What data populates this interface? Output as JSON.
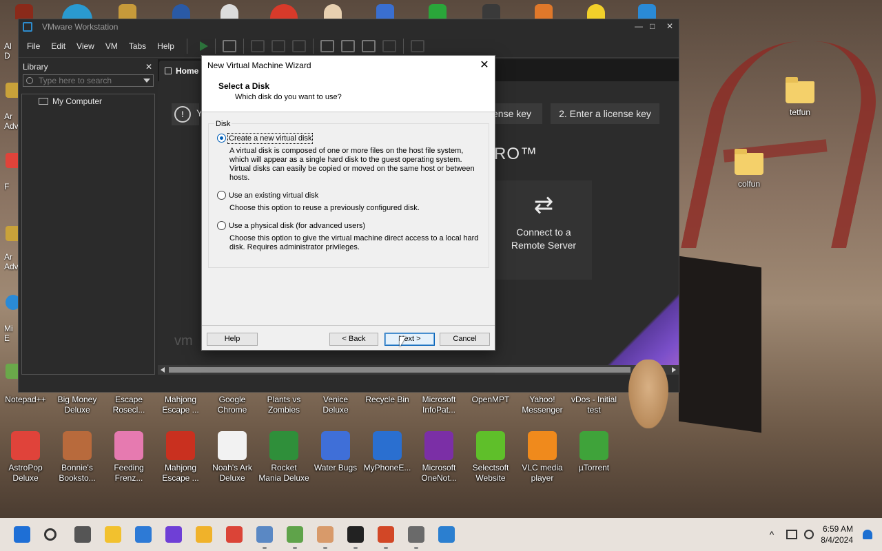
{
  "vmware": {
    "title": "VMware Workstation",
    "window_controls": {
      "minimize": "—",
      "maximize": "□",
      "close": "✕"
    },
    "menu": [
      "File",
      "Edit",
      "View",
      "VM",
      "Tabs",
      "Help"
    ],
    "library": {
      "title": "Library",
      "close": "✕",
      "search_placeholder": "Type here to search",
      "tree": [
        "My Computer"
      ]
    },
    "home_tab": "Home",
    "home": {
      "notice_glyph": "!",
      "notice_text": "Y",
      "license_btn_1": "ense key",
      "license_btn_2": "2. Enter a license key",
      "pro_mark": "RO™",
      "connect_card": {
        "line1": "Connect to a",
        "line2": "Remote Server",
        "icon": "swap-arrows-icon",
        "glyph": "⇄"
      },
      "logo_text": "vm"
    }
  },
  "dialog": {
    "title": "New Virtual Machine Wizard",
    "close": "✕",
    "heading": "Select a Disk",
    "subheading": "Which disk do you want to use?",
    "group_label": "Disk",
    "options": [
      {
        "label": "Create a new virtual disk",
        "selected": true,
        "description": "A virtual disk is composed of one or more files on the host file system, which will appear as a single hard disk to the guest operating system. Virtual disks can easily be copied or moved on the same host or between hosts."
      },
      {
        "label": "Use an existing virtual disk",
        "selected": false,
        "description": "Choose this option to reuse a previously configured disk."
      },
      {
        "label": "Use a physical disk (for advanced users)",
        "selected": false,
        "description": "Choose this option to give the virtual machine direct access to a local hard disk. Requires administrator privileges."
      }
    ],
    "buttons": {
      "help": "Help",
      "back": "< Back",
      "next": "Next >",
      "cancel": "Cancel"
    }
  },
  "desktop": {
    "right_folders": [
      "tetfun",
      "colfun"
    ],
    "row1": [
      {
        "line1": "Notepad++",
        "line2": ""
      },
      {
        "line1": "Big Money",
        "line2": "Deluxe"
      },
      {
        "line1": "Escape",
        "line2": "Rosecl..."
      },
      {
        "line1": "Mahjong",
        "line2": "Escape ..."
      },
      {
        "line1": "Google",
        "line2": "Chrome"
      },
      {
        "line1": "Plants vs",
        "line2": "Zombies"
      },
      {
        "line1": "Venice",
        "line2": "Deluxe"
      },
      {
        "line1": "Recycle Bin",
        "line2": ""
      },
      {
        "line1": "Microsoft",
        "line2": "InfoPat..."
      },
      {
        "line1": "OpenMPT",
        "line2": ""
      },
      {
        "line1": "Yahoo!",
        "line2": "Messenger"
      },
      {
        "line1": "vDos - Initial",
        "line2": "test"
      }
    ],
    "row2": [
      {
        "line1": "AstroPop",
        "line2": "Deluxe",
        "color": "#e0433a"
      },
      {
        "line1": "Bonnie's",
        "line2": "Booksto...",
        "color": "#b86a3c"
      },
      {
        "line1": "Feeding",
        "line2": "Frenz...",
        "color": "#e67ab0"
      },
      {
        "line1": "Mahjong",
        "line2": "Escape ...",
        "color": "#c9301f"
      },
      {
        "line1": "Noah's Ark",
        "line2": "Deluxe",
        "color": "#f2f2f2"
      },
      {
        "line1": "Rocket",
        "line2": "Mania Deluxe",
        "color": "#2f8f3a"
      },
      {
        "line1": "Water Bugs",
        "line2": "",
        "color": "#3f6fd8"
      },
      {
        "line1": "MyPhoneE...",
        "line2": "",
        "color": "#2a6fd0"
      },
      {
        "line1": "Microsoft",
        "line2": "OneNot...",
        "color": "#7b2fa6"
      },
      {
        "line1": "Selectsoft",
        "line2": "Website",
        "color": "#5fbf2a"
      },
      {
        "line1": "VLC media",
        "line2": "player",
        "color": "#f08a1c"
      },
      {
        "line1": "µTorrent",
        "line2": "",
        "color": "#3fa33a"
      }
    ],
    "left_partial": [
      "Al",
      "D",
      "Ar",
      "Adv",
      "F",
      "Ar",
      "Adv",
      "Mi",
      "E"
    ]
  },
  "taskbar": {
    "time": "6:59 AM",
    "date": "8/4/2024",
    "icons": [
      {
        "name": "start-icon",
        "color": "#1e6fd6"
      },
      {
        "name": "search-icon",
        "color": "#333333"
      },
      {
        "name": "task-view-icon",
        "color": "#555555"
      },
      {
        "name": "file-explorer-icon",
        "color": "#f2c12e"
      },
      {
        "name": "store-icon",
        "color": "#2d7ad6"
      },
      {
        "name": "firefox-icon",
        "color": "#6f3fd6"
      },
      {
        "name": "game-icon",
        "color": "#f0b22a"
      },
      {
        "name": "chrome-icon",
        "color": "#db4437"
      },
      {
        "name": "vmware-icon",
        "color": "#5a88c4"
      },
      {
        "name": "minecraft-icon",
        "color": "#5fa34a"
      },
      {
        "name": "character-icon",
        "color": "#d89a6a"
      },
      {
        "name": "7zip-icon",
        "color": "#222222"
      },
      {
        "name": "powerpoint-icon",
        "color": "#d24726"
      },
      {
        "name": "settings-icon",
        "color": "#6a6a6a"
      },
      {
        "name": "photos-icon",
        "color": "#2b7fd0"
      }
    ]
  }
}
